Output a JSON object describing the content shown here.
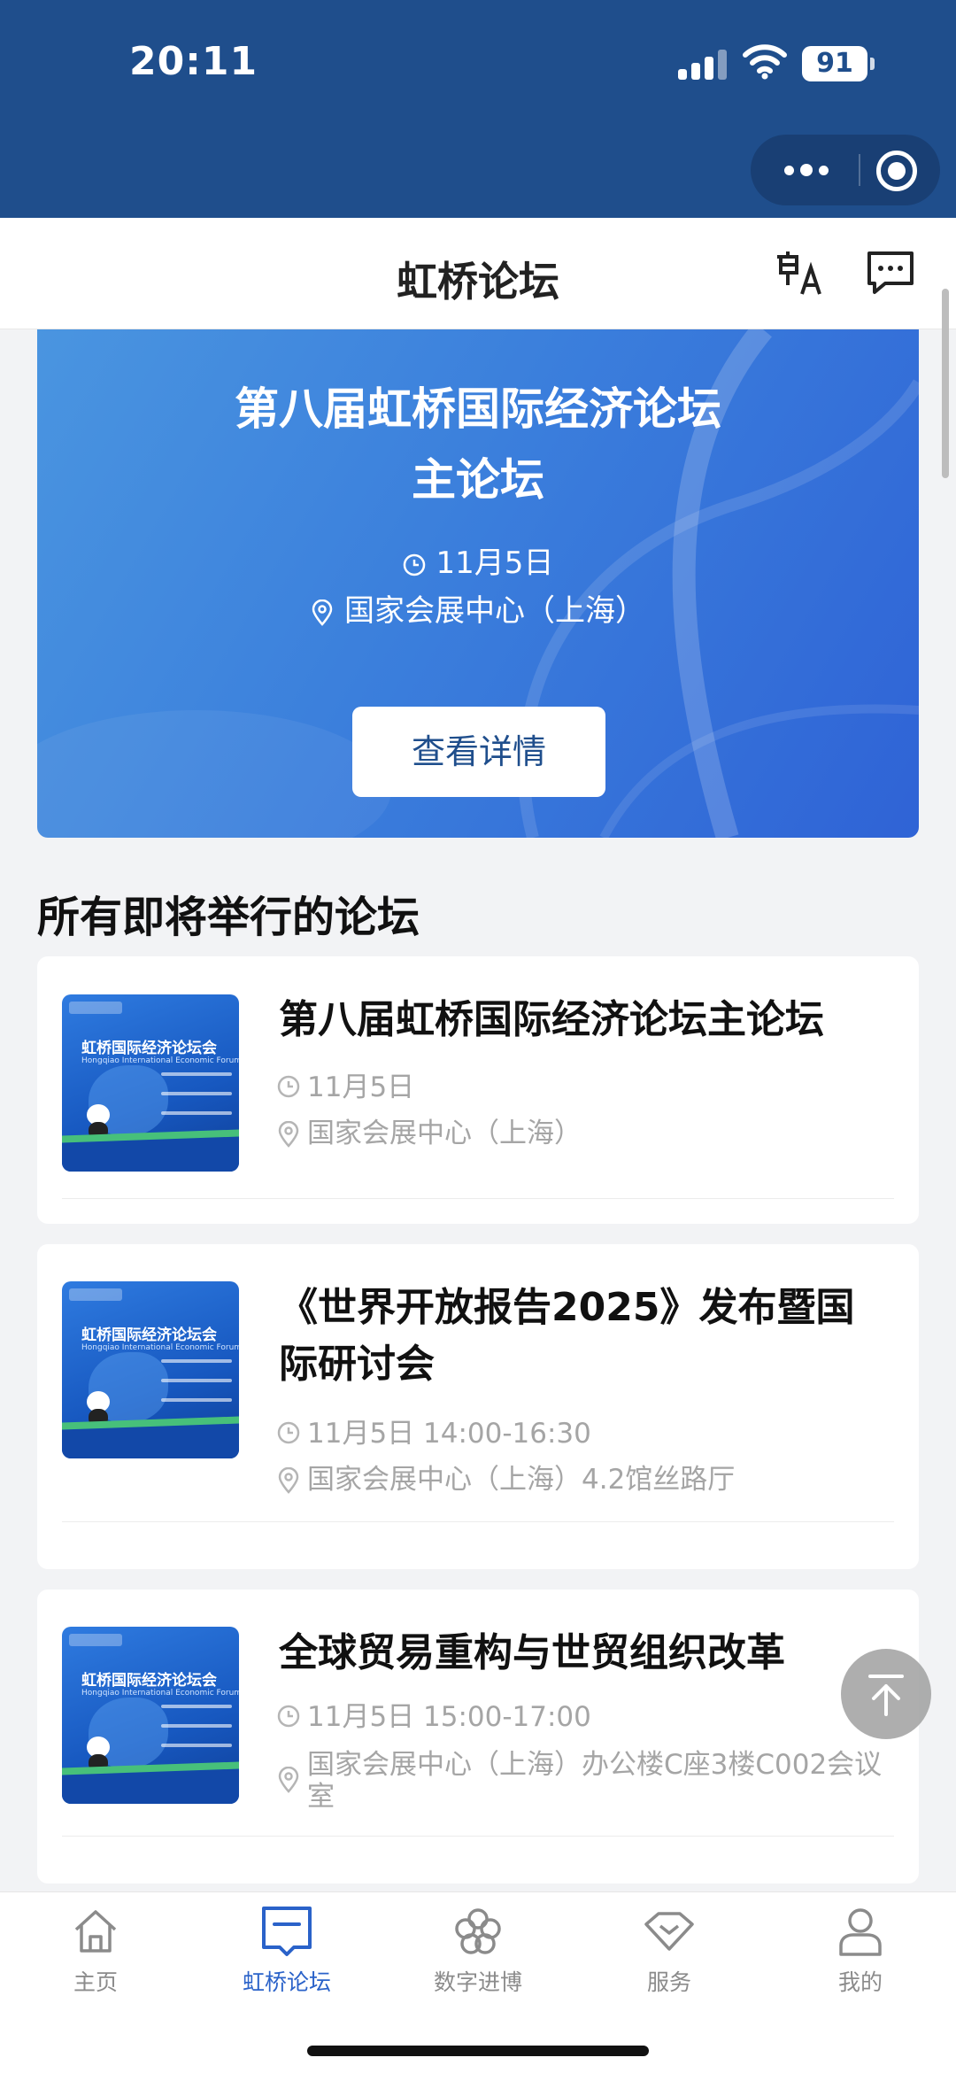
{
  "status_bar": {
    "time": "20:11",
    "battery": "91"
  },
  "header": {
    "title": "虹桥论坛"
  },
  "hero": {
    "title_line1": "第八届虹桥国际经济论坛",
    "title_line2": "主论坛",
    "date": "11月5日",
    "location": "国家会展中心（上海）",
    "button_label": "查看详情"
  },
  "section": {
    "title": "所有即将举行的论坛"
  },
  "thumbnail": {
    "title": "虹桥国际经济论坛会",
    "subtitle": "Hongqiao International Economic Forum"
  },
  "forums": [
    {
      "title": "第八届虹桥国际经济论坛主论坛",
      "time": "11月5日",
      "location": "国家会展中心（上海）"
    },
    {
      "title": "《世界开放报告2025》发布暨国际研讨会",
      "time": "11月5日 14:00-16:30",
      "location": "国家会展中心（上海）4.2馆丝路厅"
    },
    {
      "title": "全球贸易重构与世贸组织改革",
      "time": "11月5日 15:00-17:00",
      "location": "国家会展中心（上海）办公楼C座3楼C002会议室"
    }
  ],
  "tabbar": {
    "items": [
      {
        "label": "主页",
        "icon": "home-icon"
      },
      {
        "label": "虹桥论坛",
        "icon": "forum-icon",
        "active": true
      },
      {
        "label": "数字进博",
        "icon": "flower-icon"
      },
      {
        "label": "服务",
        "icon": "diamond-icon"
      },
      {
        "label": "我的",
        "icon": "person-icon"
      }
    ]
  },
  "colors": {
    "header_blue": "#1f4e8c",
    "accent": "#2a62c9",
    "muted": "#a5a5a5"
  }
}
